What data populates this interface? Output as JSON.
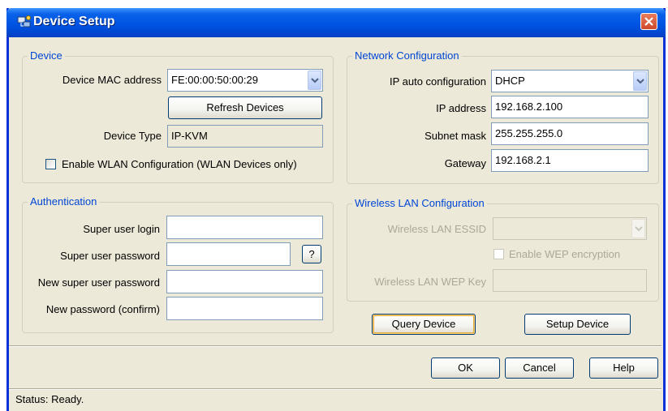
{
  "window": {
    "title": "Device Setup"
  },
  "device": {
    "group_label": "Device",
    "mac_label": "Device MAC address",
    "mac_value": "FE:00:00:50:00:29",
    "refresh_label": "Refresh Devices",
    "type_label": "Device Type",
    "type_value": "IP-KVM",
    "wlan_checkbox_label": "Enable WLAN Configuration (WLAN Devices only)",
    "wlan_checked": false
  },
  "network": {
    "group_label": "Network Configuration",
    "auto_label": "IP auto configuration",
    "auto_value": "DHCP",
    "ip_label": "IP address",
    "ip_value": "192.168.2.100",
    "mask_label": "Subnet mask",
    "mask_value": "255.255.255.0",
    "gateway_label": "Gateway",
    "gateway_value": "192.168.2.1"
  },
  "auth": {
    "group_label": "Authentication",
    "login_label": "Super user login",
    "login_value": "",
    "password_label": "Super user password",
    "password_value": "",
    "help_label": "?",
    "new_password_label": "New super user password",
    "new_password_value": "",
    "confirm_label": "New password (confirm)",
    "confirm_value": ""
  },
  "wireless": {
    "group_label": "Wireless LAN Configuration",
    "essid_label": "Wireless LAN ESSID",
    "essid_value": "",
    "wep_checkbox_label": "Enable WEP encryption",
    "wep_checked": false,
    "wep_key_label": "Wireless LAN WEP Key",
    "wep_key_value": ""
  },
  "actions": {
    "query_label": "Query Device",
    "setup_label": "Setup Device"
  },
  "footer": {
    "ok_label": "OK",
    "cancel_label": "Cancel",
    "help_label": "Help"
  },
  "status": {
    "text": "Status: Ready."
  },
  "colors": {
    "title_bar": "#0054e3",
    "group_label": "#0046d5",
    "close_button": "#cf4a2c"
  }
}
